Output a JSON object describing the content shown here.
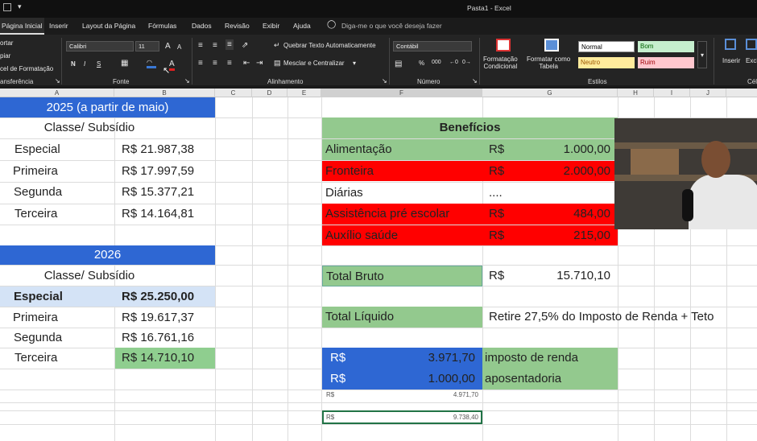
{
  "title_bar": {
    "title": "Pasta1  -  Excel"
  },
  "tabs": [
    "Página Inicial",
    "Inserir",
    "Layout da Página",
    "Fórmulas",
    "Dados",
    "Revisão",
    "Exibir",
    "Ajuda"
  ],
  "tell_me": "Diga-me o que você deseja fazer",
  "ribbon": {
    "clipboard": {
      "cut": "ortar",
      "copy": "piar",
      "format_painter": "cel de Formatação",
      "title": "ansferência"
    },
    "font": {
      "name": "Calibri",
      "size": "11",
      "bold": "N",
      "italic": "I",
      "underline": "S",
      "grow": "A",
      "shrink": "A",
      "color": "A",
      "title": "Fonte"
    },
    "alignment": {
      "wrap": "Quebrar Texto Automaticamente",
      "merge": "Mesclar e Centralizar",
      "title": "Alinhamento"
    },
    "number": {
      "format": "Contábil",
      "percent": "%",
      "comma": "000",
      "title": "Número"
    },
    "styles": {
      "conditional": "Formatação\nCondicional",
      "table": "Formatar como\nTabela",
      "normal": "Normal",
      "bom": "Bom",
      "neutro": "Neutro",
      "ruim": "Ruim",
      "title": "Estilos"
    },
    "cells": {
      "insert": "Inserir",
      "delete": "Excl",
      "title": "Cél"
    }
  },
  "columns": [
    "A",
    "B",
    "C",
    "D",
    "E",
    "F",
    "G",
    "H",
    "I",
    "J"
  ],
  "sheet": {
    "y2025": {
      "header": "2025 (a partir de maio)",
      "sub": "Classe/ Subsídio",
      "rows": [
        {
          "c": "Especial",
          "v": "R$  21.987,38"
        },
        {
          "c": "Primeira",
          "v": "R$  17.997,59"
        },
        {
          "c": "Segunda",
          "v": "R$  15.377,21"
        },
        {
          "c": "Terceira",
          "v": "R$  14.164,81"
        }
      ]
    },
    "y2026": {
      "header": "2026",
      "sub": "Classe/ Subsídio",
      "rows": [
        {
          "c": "Especial",
          "v": "R$  25.250,00"
        },
        {
          "c": "Primeira",
          "v": "R$  19.617,37"
        },
        {
          "c": "Segunda",
          "v": "R$  16.761,16"
        },
        {
          "c": "Terceira",
          "v": "R$  14.710,10"
        }
      ]
    },
    "beneficios": {
      "title": "Benefícios",
      "rows": [
        {
          "n": "Alimentação",
          "c": "R$",
          "v": "1.000,00"
        },
        {
          "n": "Fronteira",
          "c": "R$",
          "v": "2.000,00"
        },
        {
          "n": "Diárias",
          "c": "....",
          "v": ""
        },
        {
          "n": "Assistência pré escolar",
          "c": "R$",
          "v": "484,00"
        },
        {
          "n": "Auxílio saúde",
          "c": "R$",
          "v": "215,00"
        }
      ]
    },
    "total_bruto": {
      "label": "Total Bruto",
      "cur": "R$",
      "value": "15.710,10"
    },
    "total_liquido": {
      "label": "Total Líquido",
      "note": "Retire 27,5% do Imposto de Renda + Teto"
    },
    "deductions": [
      {
        "cur": "R$",
        "v": "3.971,70",
        "label": "imposto de renda"
      },
      {
        "cur": "R$",
        "v": "1.000,00",
        "label": "aposentadoria"
      }
    ],
    "sum1": {
      "cur": "R$",
      "v": "4.971,70"
    },
    "sum2": {
      "cur": "R$",
      "v": "9.738,40"
    }
  }
}
